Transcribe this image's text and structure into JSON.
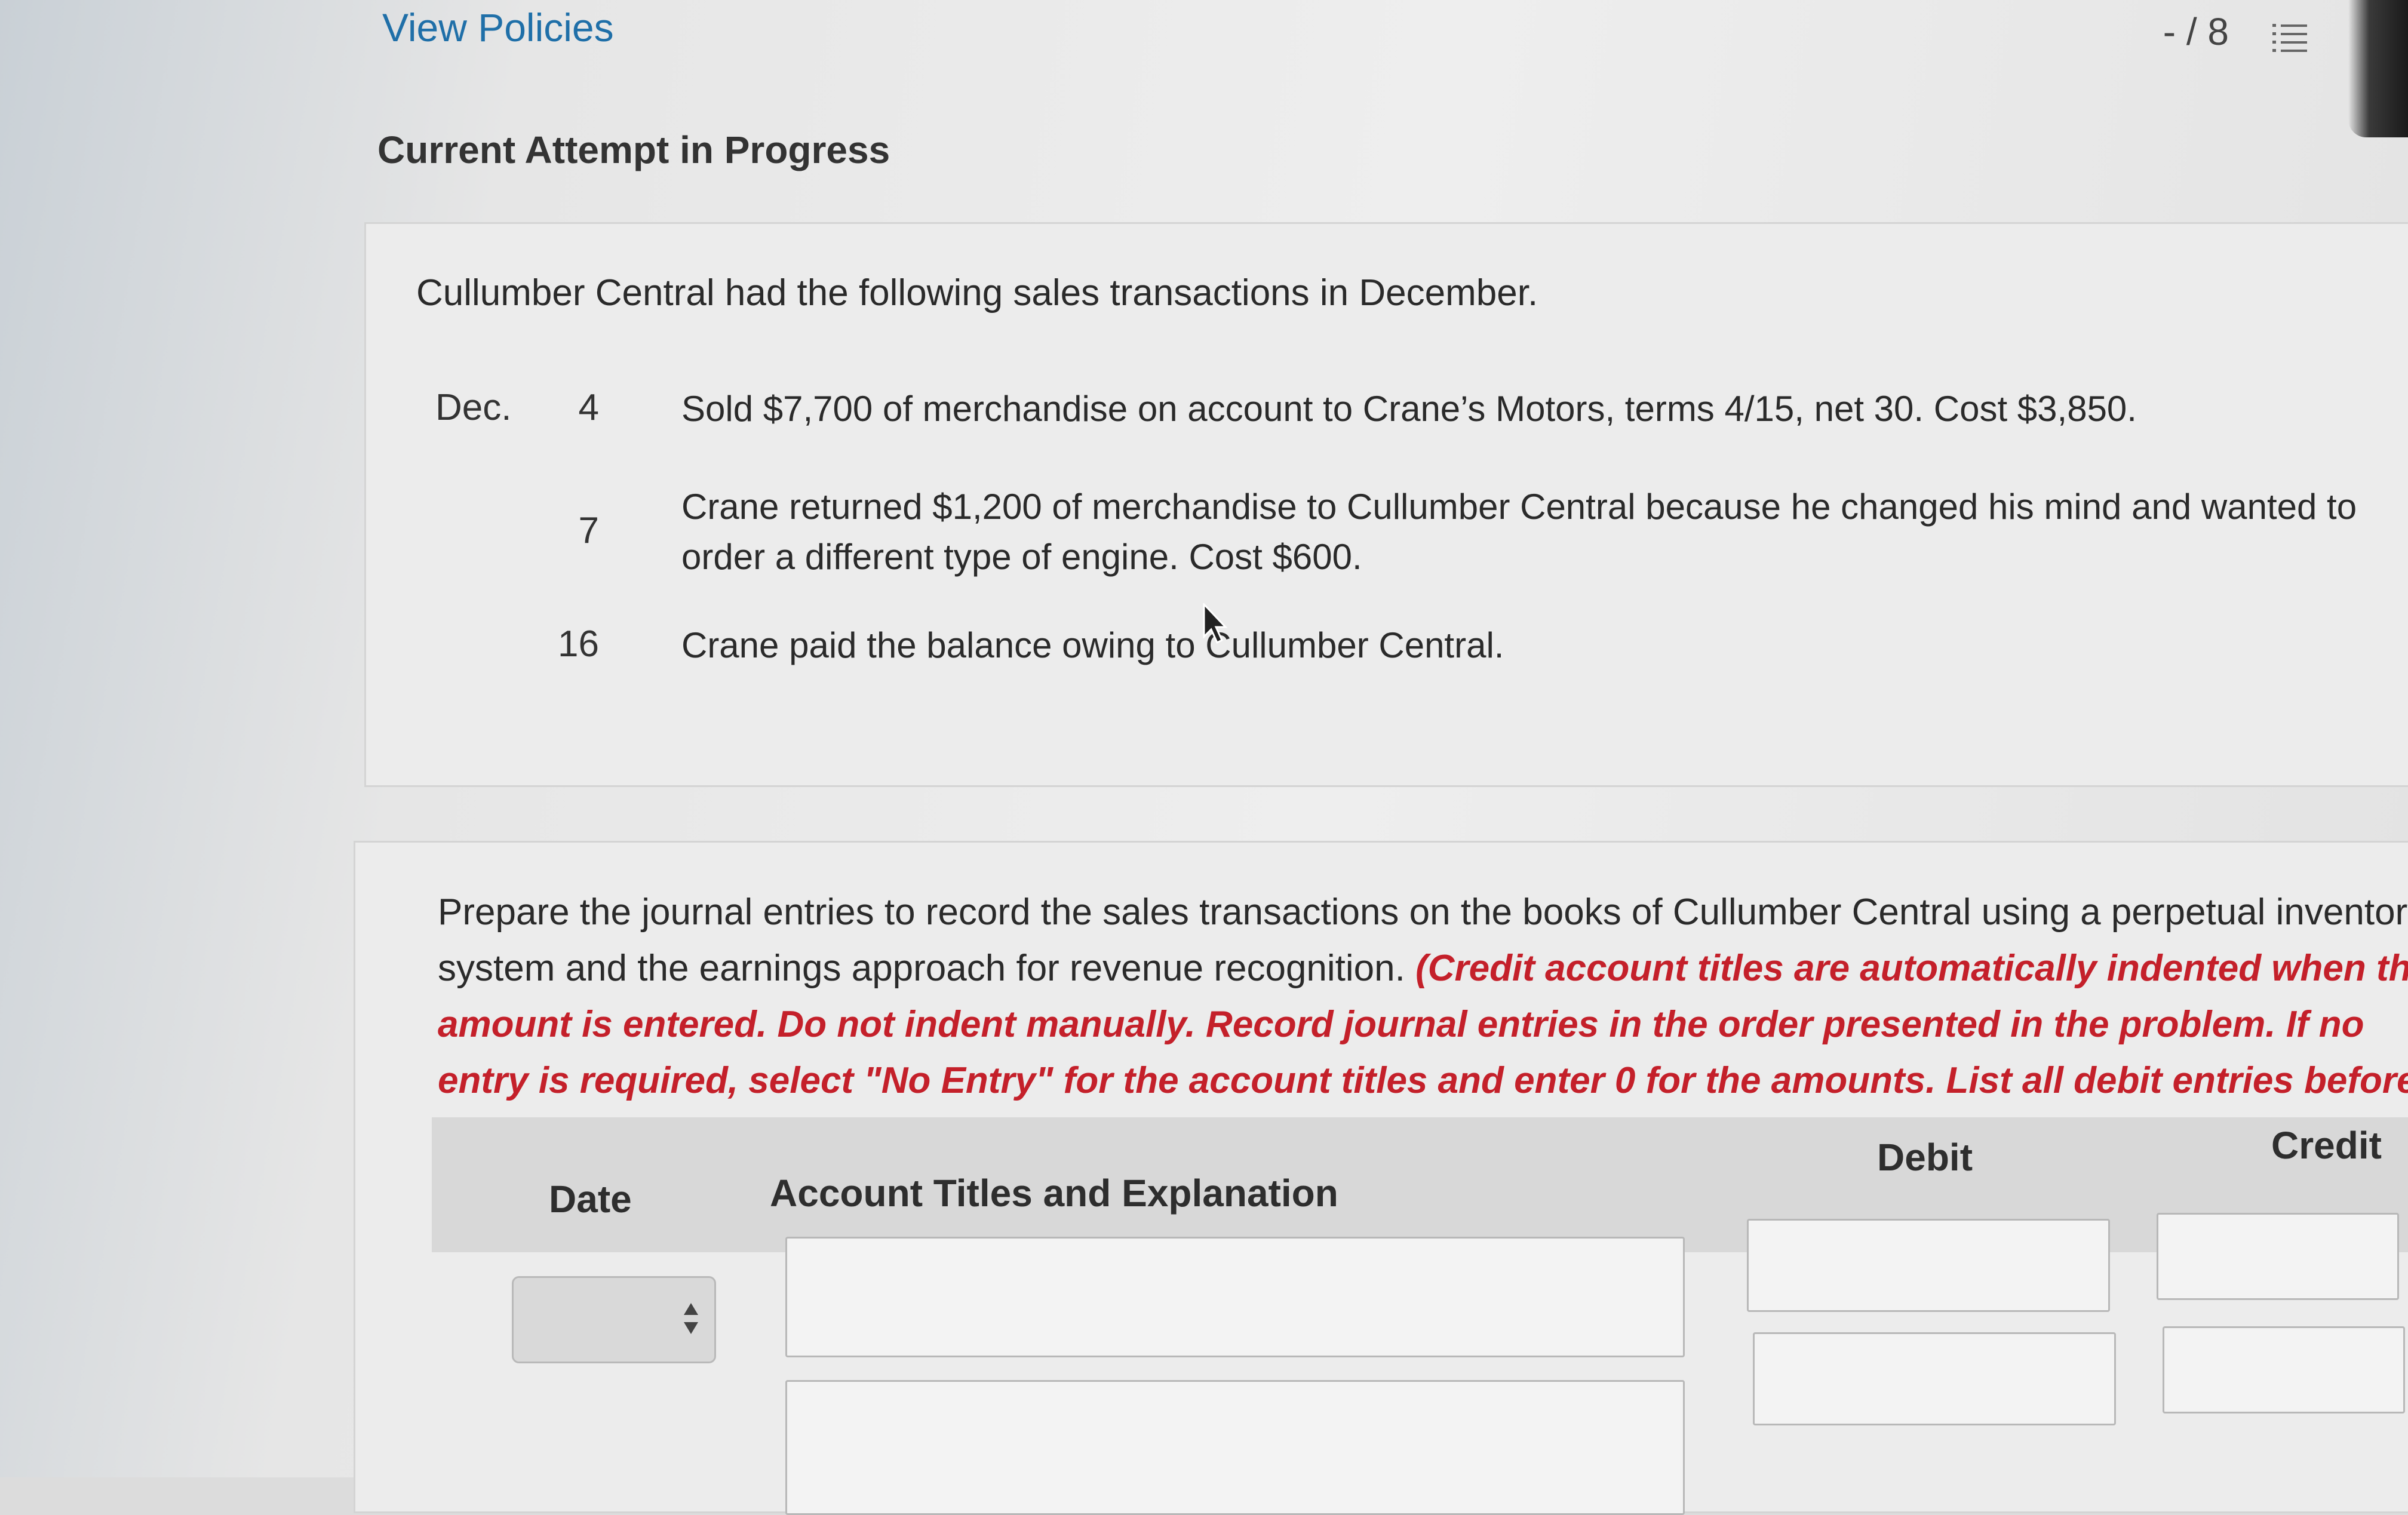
{
  "header": {
    "view_policies": "View Policies",
    "score": "- / 8",
    "list_icon": "numbered-list-icon"
  },
  "attempt_title": "Current Attempt in Progress",
  "problem": {
    "intro": "Cullumber Central had the following sales transactions in December.",
    "month": "Dec.",
    "transactions": [
      {
        "day": "4",
        "description": "Sold $7,700 of merchandise on account to Crane’s Motors, terms 4/15, net 30. Cost $3,850."
      },
      {
        "day": "7",
        "description": "Crane returned $1,200 of merchandise to Cullumber Central because he changed his mind and wanted to order a different type of engine. Cost $600."
      },
      {
        "day": "16",
        "description": "Crane paid the balance owing to Cullumber Central."
      }
    ]
  },
  "question": {
    "instruction_plain": "Prepare the journal entries to record the sales transactions on the books of Cullumber Central using a perpetual inventory system and the earnings approach for revenue recognition. ",
    "instruction_red": "(Credit account titles are automatically indented when the amount is entered. Do not indent manually. Record journal entries in the order presented in the problem. If no entry is required, select \"No Entry\" for the account titles and enter 0 for the amounts. List all debit entries before credit entries.)"
  },
  "journal_table": {
    "columns": {
      "date": "Date",
      "account": "Account Titles and Explanation",
      "debit": "Debit",
      "credit": "Credit"
    },
    "rows": [
      {
        "date": "",
        "account": "",
        "debit": "",
        "credit": ""
      },
      {
        "date": "",
        "account": "",
        "debit": "",
        "credit": ""
      }
    ]
  },
  "colors": {
    "link": "#1f6fa8",
    "instruction_red": "#c4202a"
  }
}
